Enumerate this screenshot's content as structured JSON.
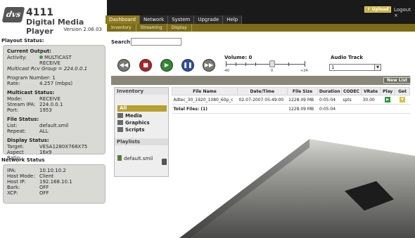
{
  "brand": {
    "logo_text": "dvs",
    "model": "4111",
    "product": "Digital Media Player",
    "version": "Version 2.06.03"
  },
  "playout": {
    "title": "Playout Status:",
    "current_output": {
      "heading": "Current Output:",
      "activity_key": "Activity:",
      "activity_value": "MULTICAST",
      "activity_sub": "RECEIVE",
      "group": "Multicast Rcv Group = 224.0.0.1",
      "program_key": "Program Number: 1",
      "rate_key": "Rate:",
      "rate_value": "4.257 (mbps)"
    },
    "multicast": {
      "heading": "Multicast Status:",
      "mode_key": "Mode:",
      "mode_value": "RECEIVE",
      "stream_key": "Stream IPA:",
      "stream_value": "224.0.0.1",
      "port_key": "Port:",
      "port_value": "1953"
    },
    "file": {
      "heading": "File Status:",
      "list_key": "List:",
      "list_value": "default.smil",
      "repeat_key": "Repeat:",
      "repeat_value": "ALL"
    },
    "display": {
      "heading": "Display Status:",
      "target_key": "Target:",
      "target_value": "VESA1280X768X75",
      "aspect_key": "Aspect Ratio:",
      "aspect_value": "16x9"
    }
  },
  "network": {
    "title": "Network Status",
    "ipa_key": "IPA:",
    "ipa_value": "10.10.10.2",
    "mode_key": "Host Mode:",
    "mode_value": "Client",
    "host_key": "Host IP:",
    "host_value": "192.168.10.1",
    "bark_key": "Bark:",
    "bark_value": "OFF",
    "xcp_key": "XCP:",
    "xcp_value": "OFF"
  },
  "nav": {
    "tabs": [
      "Dashboard",
      "Network",
      "System",
      "Upgrade",
      "Help"
    ],
    "subtabs": [
      "Inventory",
      "Streaming",
      "Display"
    ],
    "upload": "Upload",
    "logout": "Logout"
  },
  "search": {
    "label": "Search",
    "value": ""
  },
  "player": {
    "volume_label": "Volume: 0",
    "vol_min": "-40",
    "vol_mid": "0",
    "vol_max": "+24",
    "audio_label": "Audio Track",
    "audio_value": "1"
  },
  "toolbar": {
    "new_list": "New List"
  },
  "inventory": {
    "title": "Inventory",
    "all": "All",
    "media": "Media",
    "graphics": "Graphics",
    "scripts": "Scripts",
    "playlists_title": "Playlists",
    "playlist_item": "default.smil"
  },
  "table": {
    "headers": [
      "File Name",
      "Date/Time",
      "File Size",
      "Duration",
      "CODEC",
      "VRate",
      "Play",
      "Get"
    ],
    "rows": [
      [
        "Adtec_30_1920_1080_60p_c",
        "02-07-2007 05:49:00",
        "1228.09 MB",
        "0:05:04",
        "spts",
        "30.00"
      ]
    ],
    "total_label": "Total Files: (1)",
    "total_size": "1228.09 MB",
    "total_duration": "0:05:04"
  },
  "colors": {
    "accent": "#8c7a1c",
    "tab_bar": "#1a1a1a",
    "panel": "#d9d9d6"
  }
}
